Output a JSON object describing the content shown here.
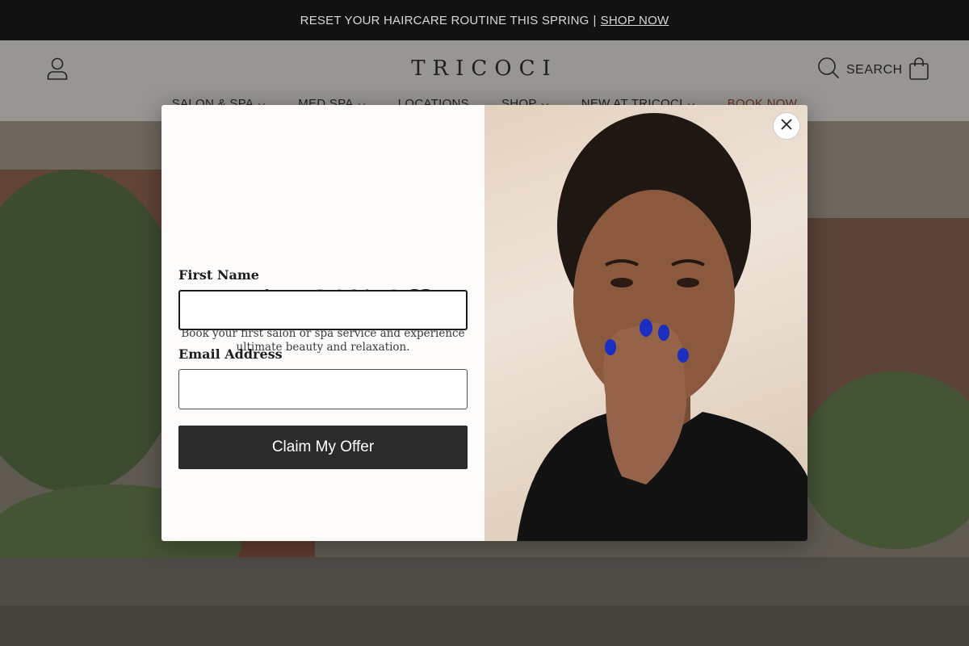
{
  "announcement": {
    "text": "RESET YOUR HAIRCARE ROUTINE THIS SPRING",
    "separator": "|",
    "link_label": "SHOP NOW"
  },
  "header": {
    "logo": "TRICOCI",
    "search_label": "SEARCH",
    "icons": [
      "account-icon",
      "search-icon",
      "cart-icon"
    ]
  },
  "nav": {
    "items": [
      {
        "label": "SALON & SPA",
        "has_dropdown": true
      },
      {
        "label": "MED SPA",
        "has_dropdown": true
      },
      {
        "label": "LOCATIONS",
        "has_dropdown": false
      },
      {
        "label": "SHOP",
        "has_dropdown": true
      },
      {
        "label": "NEW AT TRICOCI",
        "has_dropdown": true
      },
      {
        "label": "BOOK NOW",
        "has_dropdown": false
      }
    ],
    "book_color": "#9c3a2d"
  },
  "modal": {
    "title": "Enjoy 20% Off",
    "description": "Book your first salon or spa service and experience ultimate beauty and relaxation.",
    "first_name_label": "First Name",
    "first_name_value": "",
    "email_label": "Email Address",
    "email_value": "",
    "submit_label": "Claim My Offer",
    "close_icon": "close-icon",
    "button_color": "#2b2b2b"
  }
}
